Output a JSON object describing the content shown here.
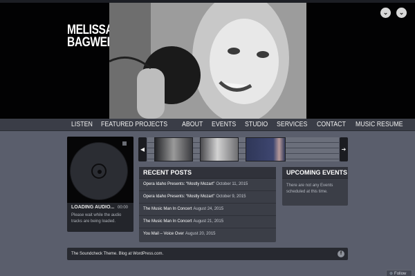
{
  "site": {
    "title_line1": "MELISSA",
    "title_line2": "BAGWELL"
  },
  "hero": {
    "prev_icon": "chevron-down-icon",
    "next_icon": "chevron-down-icon",
    "prev_glyph": "⌄",
    "next_glyph": "⌄"
  },
  "nav": {
    "items": [
      "LISTEN",
      "FEATURED PROJECTS",
      "ABOUT",
      "EVENTS",
      "STUDIO",
      "SERVICES",
      "CONTACT",
      "MUSIC RESUME"
    ]
  },
  "player": {
    "status": "LOADING AUDIO...",
    "time": "00:00",
    "message": "Please wait while the audio tracks are being loaded."
  },
  "carousel": {
    "prev_glyph": "◀",
    "next_glyph": "➔"
  },
  "recent_posts": {
    "heading": "RECENT POSTS",
    "items": [
      {
        "title": "Opera Idaho Presents: “Mostly Mozart”",
        "date": "October 11, 2015"
      },
      {
        "title": "Opera Idaho Presents: “Mostly Mozart”",
        "date": "October 9, 2015"
      },
      {
        "title": "The Music Man In Concert",
        "date": "August 24, 2015"
      },
      {
        "title": "The Music Man In Concert",
        "date": "August 21, 2015"
      },
      {
        "title": "You Mail – Voice Over",
        "date": "August 20, 2015"
      }
    ]
  },
  "upcoming_events": {
    "heading": "UPCOMING EVENTS",
    "text": "There are not any Events scheduled at this time."
  },
  "footer": {
    "text": "The Soundcheck Theme. Blog at WordPress.com.",
    "fb_glyph": "f"
  },
  "follow": {
    "label": "Follow"
  },
  "colors": {
    "background": "#5a5e6c",
    "header": "#020203",
    "nav": "#3a3d47",
    "panel": "#3b3e47"
  }
}
